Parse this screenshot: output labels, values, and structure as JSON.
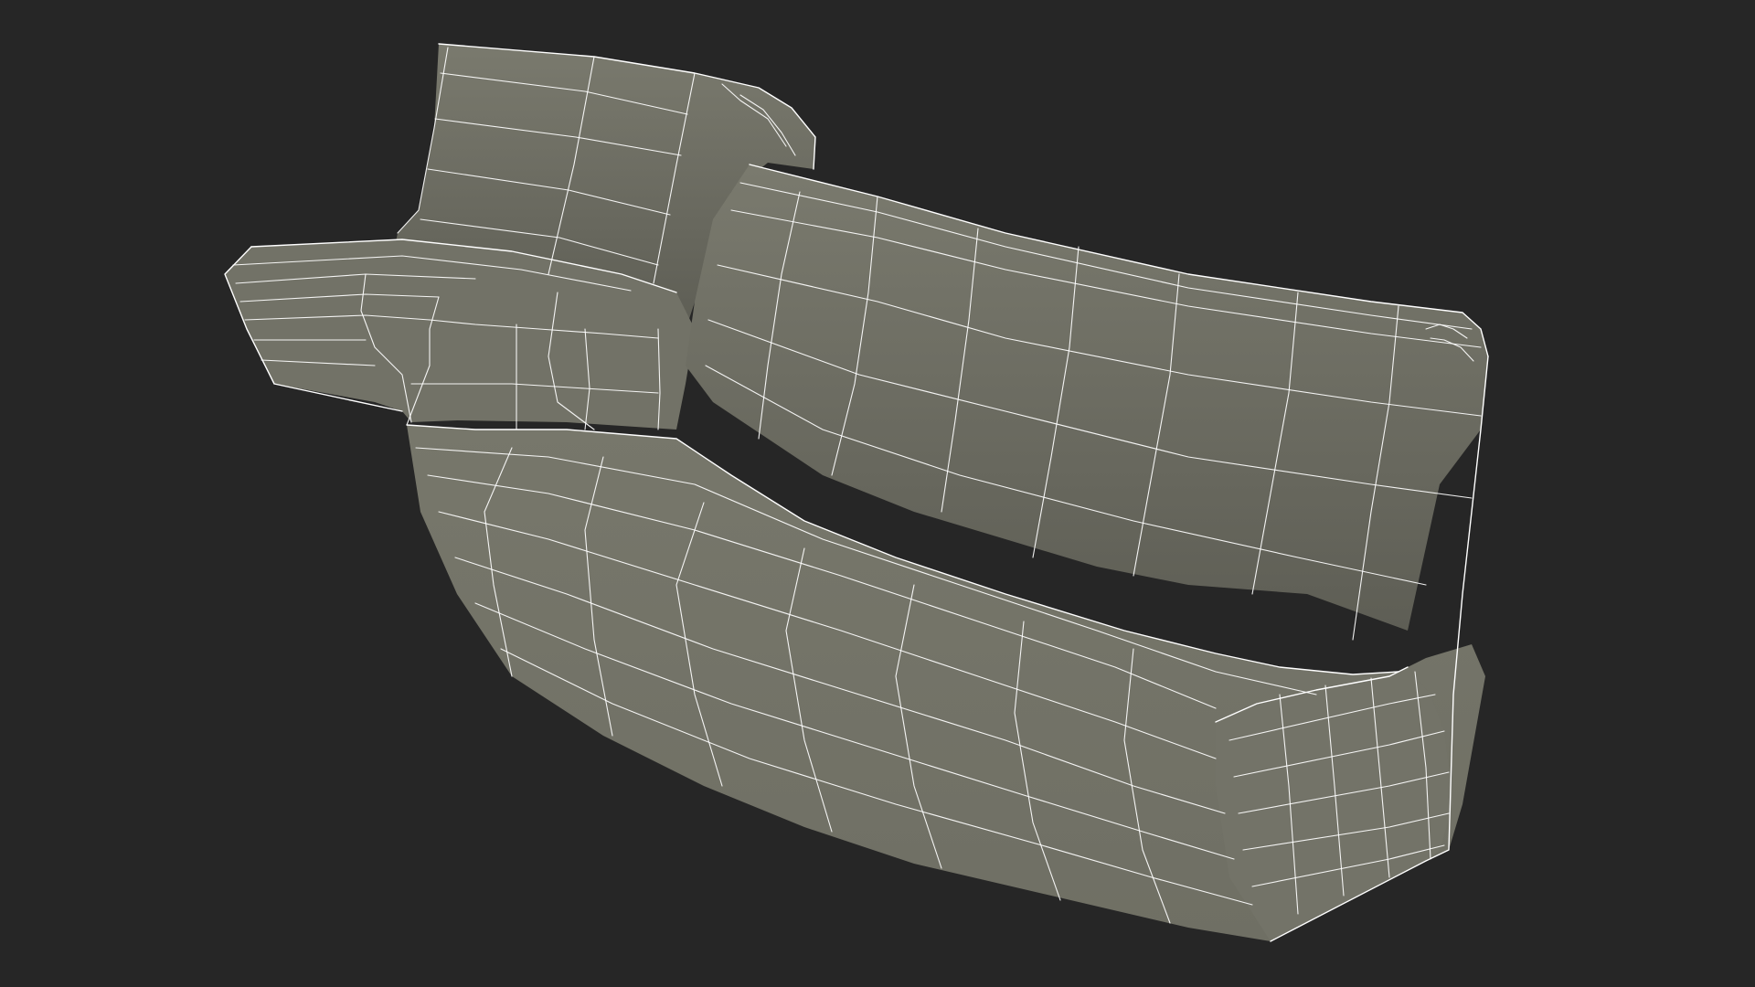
{
  "scene": {
    "background_color": "#262626",
    "surface_color": "#747468",
    "surface_shadow_color": "#5f5f55",
    "wire_color": "#ffffff",
    "object": "curved-sofa-wireframe-model",
    "view": "perspective"
  }
}
